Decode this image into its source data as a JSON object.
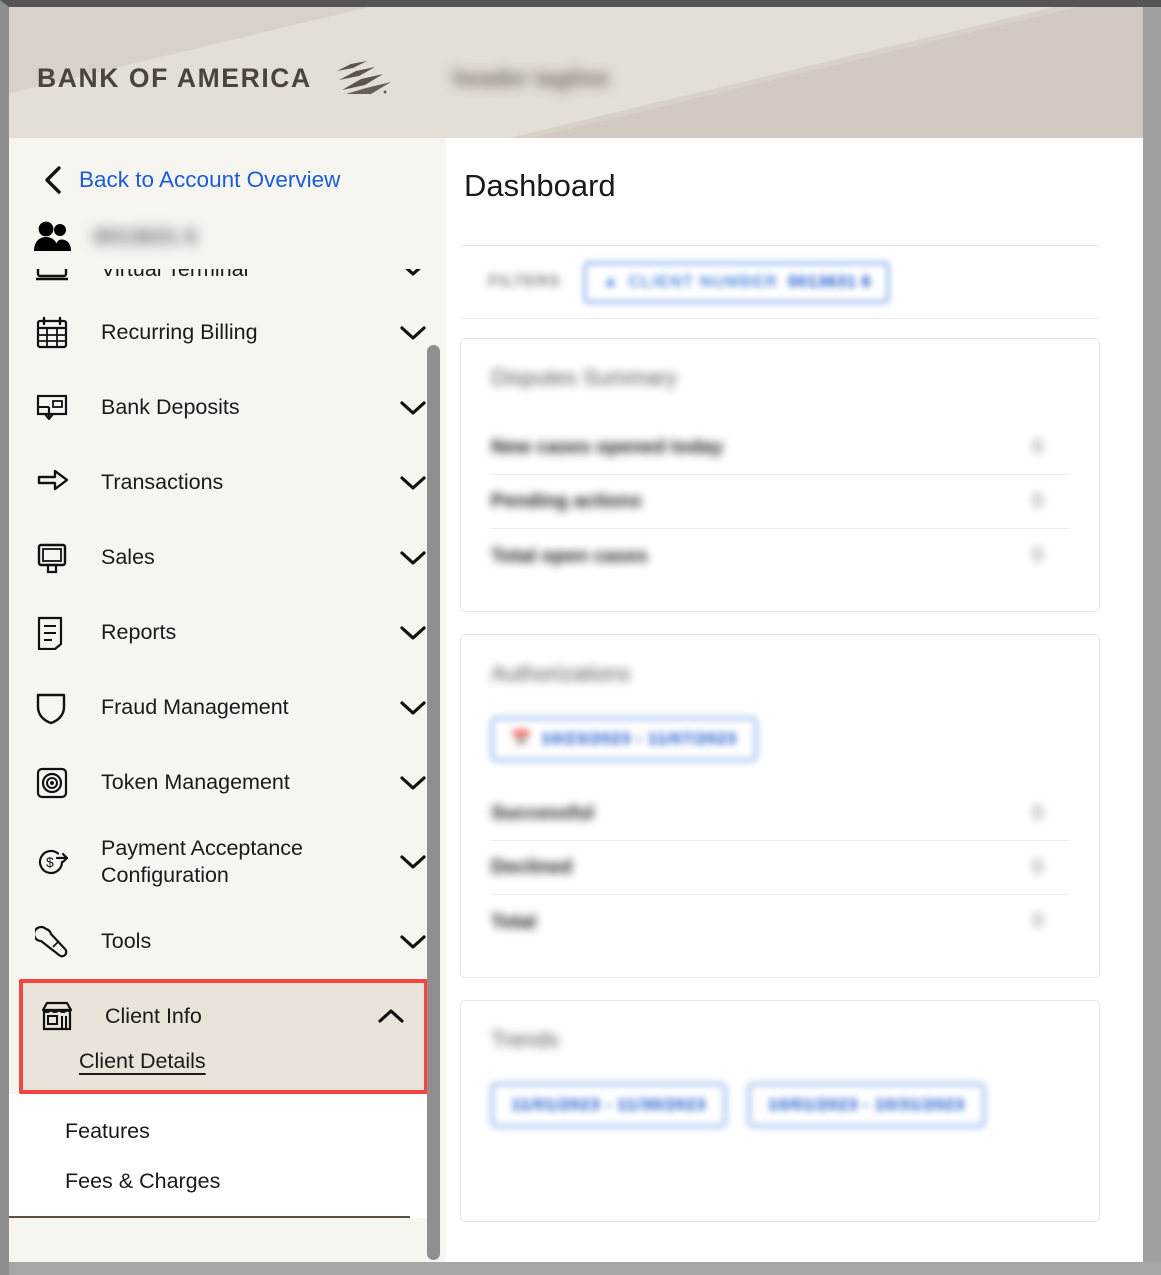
{
  "header": {
    "wordmark": "BANK OF AMERICA",
    "tagline": "header tagline",
    "logo_icon": "boa-flag-icon"
  },
  "sidebar": {
    "back_link": {
      "label": "Back to Account Overview",
      "icon": "chevron-left-icon"
    },
    "client": {
      "icon": "users-icon",
      "number": "0013631 6"
    },
    "nav_items": [
      {
        "label": "Virtual Terminal",
        "icon": "terminal-icon",
        "chevron": "chevron-down-icon",
        "truncated": true
      },
      {
        "label": "Recurring Billing",
        "icon": "calendar-icon",
        "chevron": "chevron-down-icon"
      },
      {
        "label": "Bank Deposits",
        "icon": "deposit-icon",
        "chevron": "chevron-down-icon"
      },
      {
        "label": "Transactions",
        "icon": "exchange-arrows-icon",
        "chevron": "chevron-down-icon"
      },
      {
        "label": "Sales",
        "icon": "pos-terminal-icon",
        "chevron": "chevron-down-icon"
      },
      {
        "label": "Reports",
        "icon": "document-icon",
        "chevron": "chevron-down-icon"
      },
      {
        "label": "Fraud Management",
        "icon": "shield-icon",
        "chevron": "chevron-down-icon"
      },
      {
        "label": "Token Management",
        "icon": "token-icon",
        "chevron": "chevron-down-icon"
      },
      {
        "label": "Payment Acceptance Configuration",
        "icon": "dollar-arrow-icon",
        "chevron": "chevron-down-icon"
      },
      {
        "label": "Tools",
        "icon": "wrench-icon",
        "chevron": "chevron-down-icon"
      }
    ],
    "client_info_group": {
      "label": "Client Info",
      "icon": "store-icon",
      "chevron": "chevron-up-icon",
      "selected_sub_item": "Client Details",
      "highlight_color": "#f4453f",
      "highlight_bg": "#e9e3d9"
    },
    "sub_items": [
      {
        "label": "Features"
      },
      {
        "label": "Fees & Charges"
      }
    ],
    "scrollbar": {
      "present": true
    }
  },
  "main": {
    "page_title": "Dashboard",
    "filters": {
      "label": "FILTERS",
      "chip": {
        "icon": "person-filter-icon",
        "label": "CLIENT NUMBER",
        "value": "0013631 6"
      }
    },
    "cards": [
      {
        "title": "Disputes Summary",
        "rows": [
          {
            "label": "New cases opened today",
            "value": "0"
          },
          {
            "label": "Pending actions",
            "value": "0"
          },
          {
            "label": "Total open cases",
            "value": "0"
          }
        ]
      },
      {
        "title": "Authorizations",
        "date_chip": {
          "icon": "calendar-icon",
          "text": "10/23/2023 - 11/07/2023"
        },
        "rows": [
          {
            "label": "Successful",
            "value": "0"
          },
          {
            "label": "Declined",
            "value": "0"
          },
          {
            "label": "Total",
            "value": "0"
          }
        ]
      },
      {
        "title": "Trends",
        "date_chips": [
          {
            "text": "11/01/2023 - 11/30/2023"
          },
          {
            "text": "10/01/2023 - 10/31/2023"
          }
        ]
      }
    ]
  },
  "colors": {
    "link_blue": "#1b5dd4",
    "header_beige": "#d8d1c8",
    "sidebar_bg": "#f7f5f0",
    "highlight_red": "#f4453f",
    "chip_blue": "#4a85e8"
  }
}
